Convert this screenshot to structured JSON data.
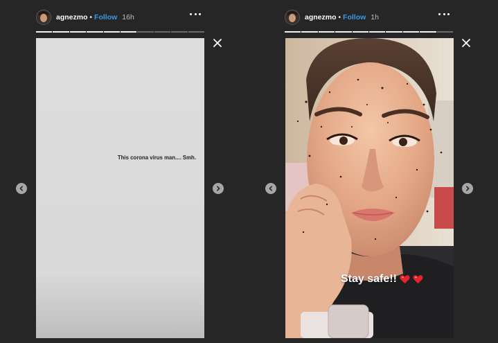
{
  "stories": [
    {
      "username": "agnezmo",
      "separator": "•",
      "follow_label": "Follow",
      "time": "16h",
      "more_icon": "more-horizontal-icon",
      "close_icon": "close-icon",
      "progress_total": 10,
      "progress_done": 6,
      "content_text": "This corona virus man.... Smh."
    },
    {
      "username": "agnezmo",
      "separator": "•",
      "follow_label": "Follow",
      "time": "1h",
      "more_icon": "more-horizontal-icon",
      "close_icon": "close-icon",
      "progress_total": 10,
      "progress_done": 9,
      "caption_text": "Stay safe!!",
      "caption_icons": [
        "heart-icon",
        "heart-icon"
      ]
    }
  ],
  "nav": {
    "prev_icon": "chevron-left-icon",
    "next_icon": "chevron-right-icon"
  },
  "colors": {
    "background": "#262626",
    "follow": "#3c98e6",
    "heart": "#e3242b",
    "story_grey": "#dadada"
  }
}
